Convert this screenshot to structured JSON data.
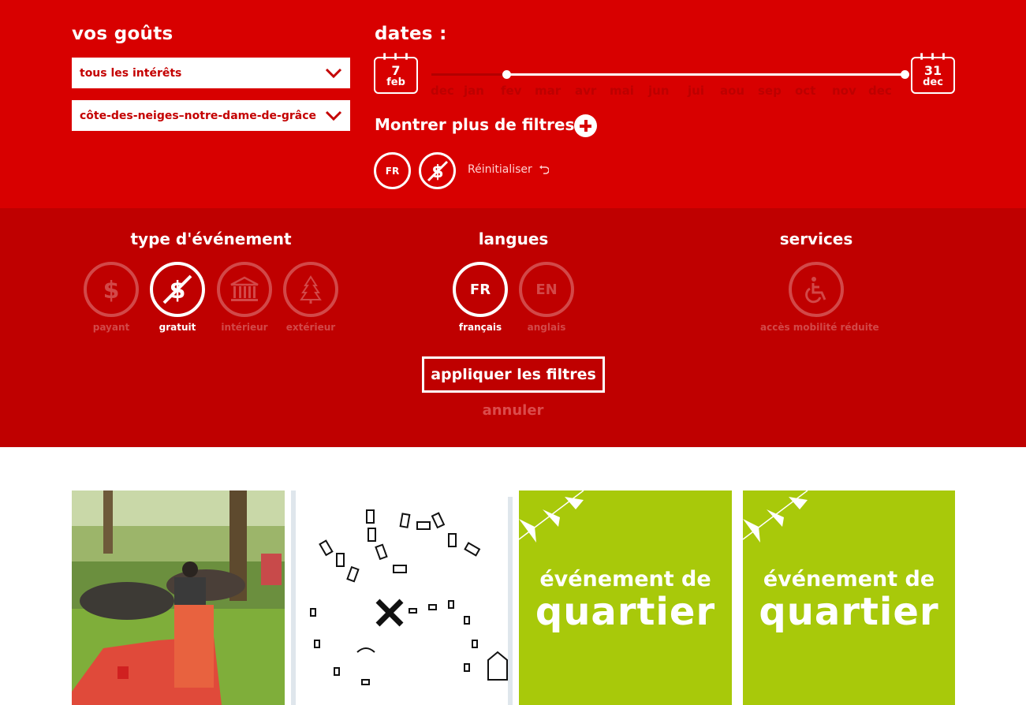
{
  "prefs": {
    "title": "vos goûts",
    "interests_value": "tous les intérêts",
    "district_value": "côte-des-neiges–notre-dame-de-grâce"
  },
  "dates": {
    "title": "dates :",
    "start_day": "7",
    "start_month": "feb",
    "end_day": "31",
    "end_month": "dec",
    "months": [
      "dec",
      "jan",
      "fev",
      "mar",
      "avr",
      "mai",
      "jun",
      "jui",
      "aou",
      "sep",
      "oct",
      "nov",
      "dec"
    ]
  },
  "more_filters": {
    "label": "Montrer plus de filtres"
  },
  "active_chips": {
    "lang": "FR"
  },
  "reset": {
    "label": "Réinitialiser"
  },
  "event_type": {
    "title": "type d'événement",
    "options": [
      {
        "label": "payant",
        "icon": "dollar-icon",
        "selected": false
      },
      {
        "label": "gratuit",
        "icon": "no-dollar-icon",
        "selected": true
      },
      {
        "label": "intérieur",
        "icon": "building-icon",
        "selected": false
      },
      {
        "label": "extérieur",
        "icon": "tree-icon",
        "selected": false
      }
    ]
  },
  "languages": {
    "title": "langues",
    "options": [
      {
        "code": "FR",
        "label": "français",
        "selected": true
      },
      {
        "code": "EN",
        "label": "anglais",
        "selected": false
      }
    ]
  },
  "services": {
    "title": "services",
    "options": [
      {
        "label": "accès mobilité réduite",
        "icon": "wheelchair-icon",
        "selected": false
      }
    ]
  },
  "actions": {
    "apply": "appliquer les filtres",
    "cancel": "annuler"
  },
  "cards": [
    {
      "kind": "photo"
    },
    {
      "kind": "drawing"
    },
    {
      "kind": "placeholder",
      "line1": "événement de",
      "line2": "quartier"
    },
    {
      "kind": "placeholder",
      "line1": "événement de",
      "line2": "quartier"
    }
  ],
  "colors": {
    "red": "#d80000",
    "panel_red": "#bf0000",
    "green": "#a8c90a"
  }
}
